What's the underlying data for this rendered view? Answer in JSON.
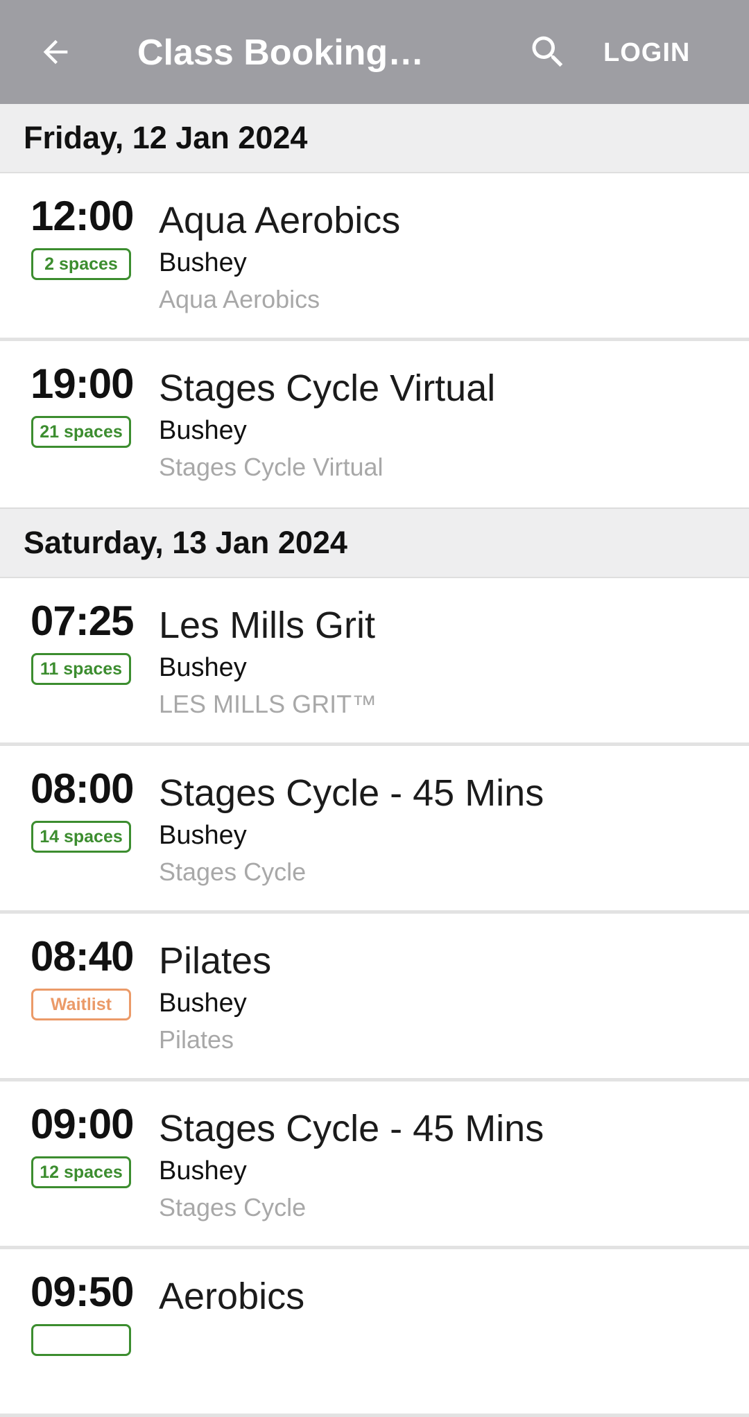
{
  "header": {
    "title": "Class Bookings…",
    "login_label": "LOGIN",
    "back_icon": "arrow-left-icon",
    "search_icon": "search-icon",
    "background_color": "#9e9ea3"
  },
  "days": [
    {
      "date": "Friday, 12 Jan 2024",
      "classes": [
        {
          "time": "12:00",
          "badge": "2 spaces",
          "status": "available",
          "name": "Aqua Aerobics",
          "location": "Bushey",
          "category": "Aqua Aerobics"
        },
        {
          "time": "19:00",
          "badge": "21 spaces",
          "status": "available",
          "name": "Stages Cycle Virtual",
          "location": "Bushey",
          "category": "Stages Cycle Virtual"
        }
      ]
    },
    {
      "date": "Saturday, 13 Jan 2024",
      "classes": [
        {
          "time": "07:25",
          "badge": "11 spaces",
          "status": "available",
          "name": "Les Mills Grit",
          "location": "Bushey",
          "category": "LES MILLS GRIT™"
        },
        {
          "time": "08:00",
          "badge": "14 spaces",
          "status": "available",
          "name": "Stages Cycle - 45 Mins",
          "location": "Bushey",
          "category": "Stages Cycle"
        },
        {
          "time": "08:40",
          "badge": "Waitlist",
          "status": "waitlist",
          "name": "Pilates",
          "location": "Bushey",
          "category": "Pilates"
        },
        {
          "time": "09:00",
          "badge": "12 spaces",
          "status": "available",
          "name": "Stages Cycle - 45 Mins",
          "location": "Bushey",
          "category": "Stages Cycle"
        },
        {
          "time": "09:50",
          "badge": "",
          "status": "available",
          "name": "Aerobics",
          "location": "",
          "category": ""
        }
      ]
    }
  ],
  "colors": {
    "available": "#3c8d2f",
    "waitlist": "#eb9a68",
    "day_header_bg": "#eeeeef"
  }
}
